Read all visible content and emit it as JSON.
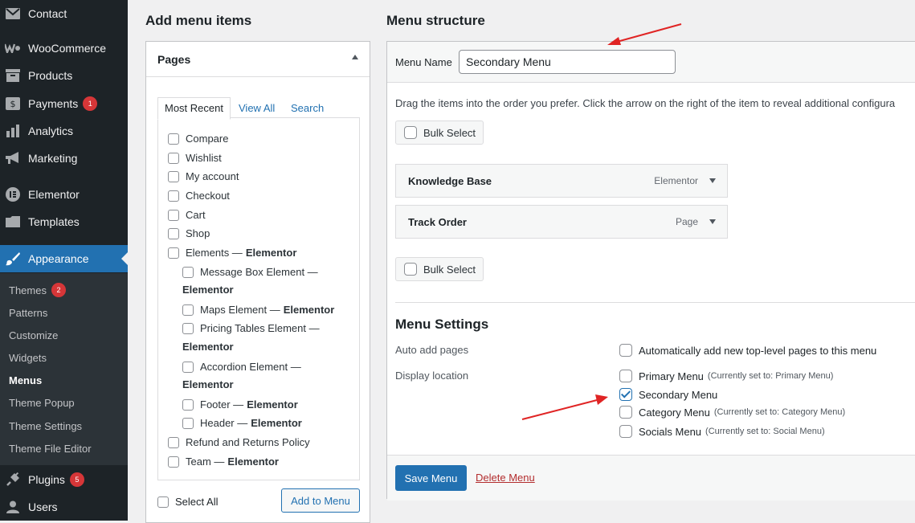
{
  "sidebar": {
    "items": [
      {
        "id": "contact",
        "label": "Contact",
        "icon": "mail-icon"
      },
      {
        "id": "woocommerce",
        "label": "WooCommerce",
        "icon": "woocommerce-icon"
      },
      {
        "id": "products",
        "label": "Products",
        "icon": "archive-icon"
      },
      {
        "id": "payments",
        "label": "Payments",
        "badge": "1",
        "icon": "payments-icon"
      },
      {
        "id": "analytics",
        "label": "Analytics",
        "icon": "bar-chart-icon"
      },
      {
        "id": "marketing",
        "label": "Marketing",
        "icon": "megaphone-icon"
      },
      {
        "id": "elementor",
        "label": "Elementor",
        "icon": "elementor-icon"
      },
      {
        "id": "templates",
        "label": "Templates",
        "icon": "folder-icon"
      },
      {
        "id": "appearance",
        "label": "Appearance",
        "icon": "paintbrush-icon"
      },
      {
        "id": "plugins",
        "label": "Plugins",
        "badge": "5",
        "icon": "plugin-icon"
      },
      {
        "id": "users",
        "label": "Users",
        "icon": "user-icon"
      }
    ],
    "submenu": [
      {
        "label": "Themes",
        "badge": "2"
      },
      {
        "label": "Patterns"
      },
      {
        "label": "Customize"
      },
      {
        "label": "Widgets"
      },
      {
        "label": "Menus",
        "active": true
      },
      {
        "label": "Theme Popup"
      },
      {
        "label": "Theme Settings"
      },
      {
        "label": "Theme File Editor"
      }
    ]
  },
  "add_items": {
    "heading": "Add menu items",
    "box_title": "Pages",
    "tabs": [
      "Most Recent",
      "View All",
      "Search"
    ],
    "pages": [
      {
        "label": "Compare"
      },
      {
        "label": "Wishlist"
      },
      {
        "label": "My account"
      },
      {
        "label": "Checkout"
      },
      {
        "label": "Cart"
      },
      {
        "label": "Shop"
      },
      {
        "label": "Elements —",
        "suffix": "Elementor"
      },
      {
        "label": "Message Box Element —",
        "suffix": "Elementor"
      },
      {
        "label": "Maps Element —",
        "suffix": "Elementor"
      },
      {
        "label": "Pricing Tables Element —",
        "suffix": "Elementor"
      },
      {
        "label": "Accordion Element —",
        "suffix": "Elementor"
      },
      {
        "label": "Footer —",
        "suffix": "Elementor"
      },
      {
        "label": "Header —",
        "suffix": "Elementor"
      },
      {
        "label": "Refund and Returns Policy"
      },
      {
        "label": "Team —",
        "suffix": "Elementor"
      }
    ],
    "select_all": "Select All",
    "add_button": "Add to Menu"
  },
  "structure": {
    "heading": "Menu structure",
    "menu_name_label": "Menu Name",
    "menu_name_value": "Secondary Menu",
    "instructions": "Drag the items into the order you prefer. Click the arrow on the right of the item to reveal additional configura",
    "bulk_select": "Bulk Select",
    "items": [
      {
        "title": "Knowledge Base",
        "type": "Elementor"
      },
      {
        "title": "Track Order",
        "type": "Page"
      }
    ],
    "settings": {
      "title": "Menu Settings",
      "auto_add_label": "Auto add pages",
      "auto_add_option": "Automatically add new top-level pages to this menu",
      "display_label": "Display location",
      "locations": [
        {
          "label": "Primary Menu",
          "note": "(Currently set to: Primary Menu)",
          "checked": false
        },
        {
          "label": "Secondary Menu",
          "note": "",
          "checked": true
        },
        {
          "label": "Category Menu",
          "note": "(Currently set to: Category Menu)",
          "checked": false
        },
        {
          "label": "Socials Menu",
          "note": "(Currently set to: Social Menu)",
          "checked": false
        }
      ]
    },
    "save_button": "Save Menu",
    "delete_link": "Delete Menu"
  },
  "colors": {
    "sidebar_bg": "#1d2327",
    "accent": "#2271b1",
    "badge": "#d63638",
    "annotation_arrow": "#e02424"
  }
}
